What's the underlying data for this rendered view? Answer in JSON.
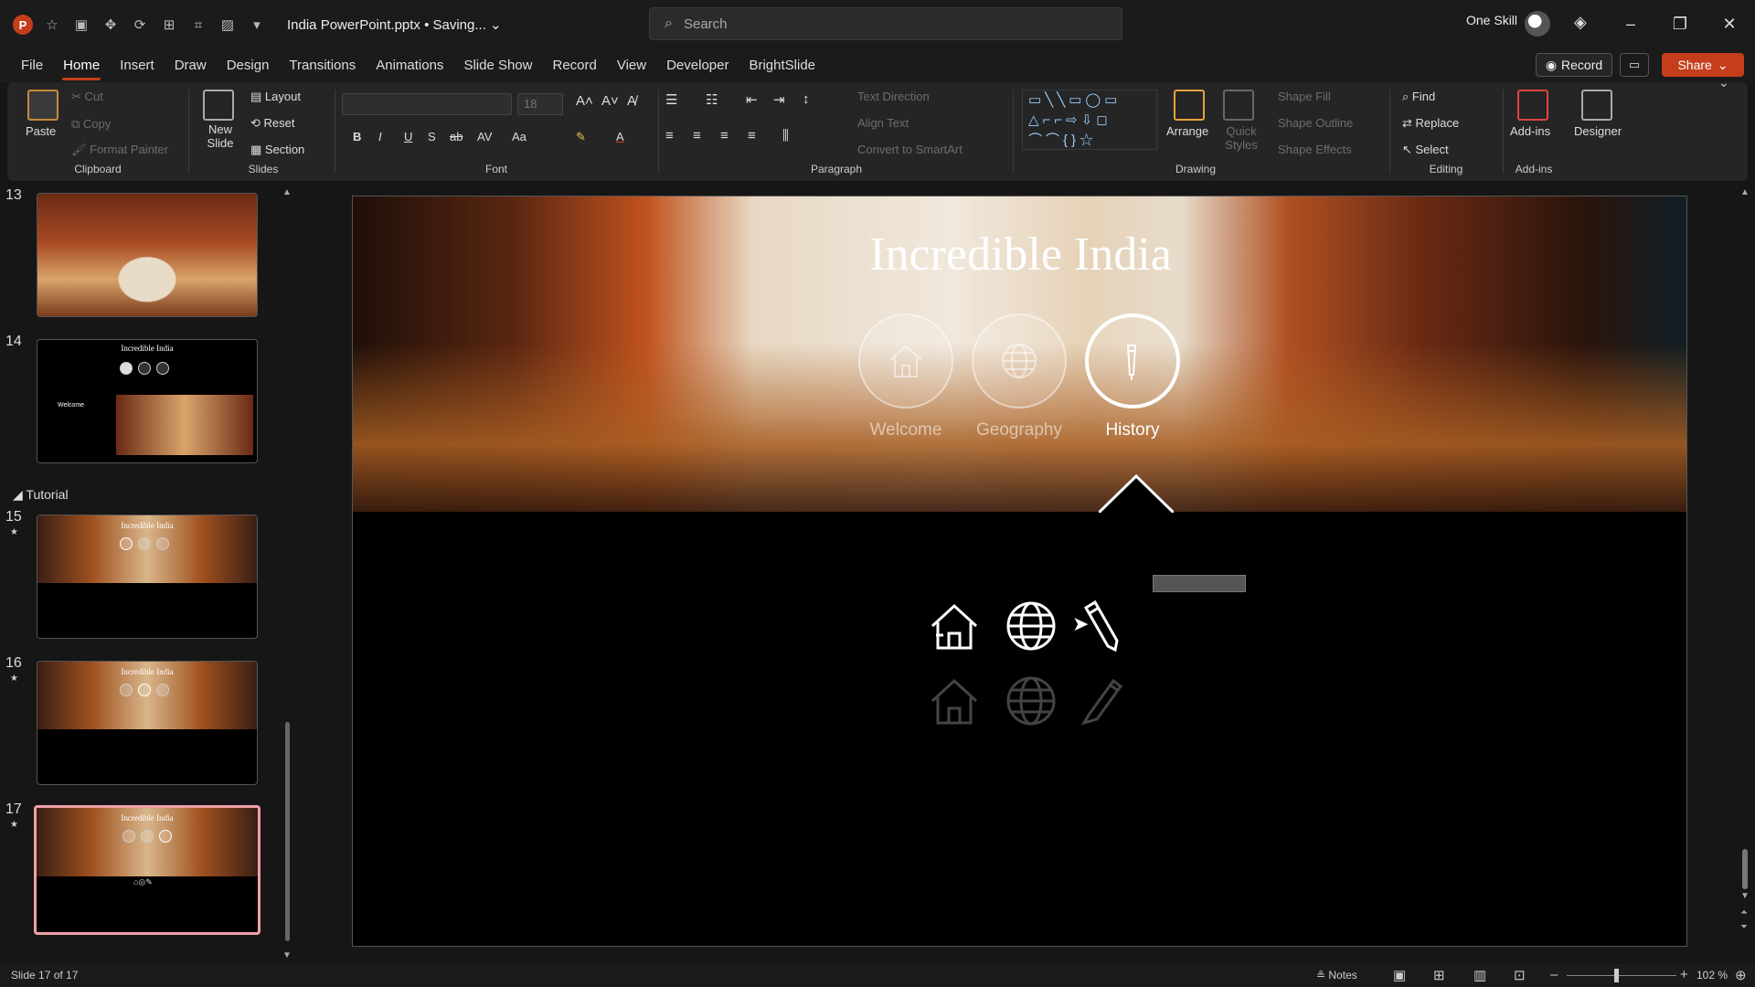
{
  "window": {
    "doc_title": "India PowerPoint.pptx • Saving...",
    "search_placeholder": "Search",
    "user_name": "One Skill"
  },
  "menu_tabs": [
    "File",
    "Home",
    "Insert",
    "Draw",
    "Design",
    "Transitions",
    "Animations",
    "Slide Show",
    "Record",
    "View",
    "Developer",
    "BrightSlide"
  ],
  "header_buttons": {
    "record": "Record",
    "share": "Share"
  },
  "ribbon": {
    "clipboard": {
      "label": "Clipboard",
      "paste": "Paste",
      "cut": "Cut",
      "copy": "Copy",
      "format_painter": "Format Painter"
    },
    "slides": {
      "label": "Slides",
      "new_slide": "New Slide",
      "layout": "Layout",
      "reset": "Reset",
      "section": "Section"
    },
    "font": {
      "label": "Font",
      "font_size": "18",
      "bold": "B",
      "italic": "I",
      "underline": "U",
      "shadow": "S",
      "strike": "ab",
      "spacing": "AV",
      "case": "Aa"
    },
    "paragraph": {
      "label": "Paragraph",
      "text_direction": "Text Direction",
      "align_text": "Align Text",
      "convert_smartart": "Convert to SmartArt"
    },
    "drawing": {
      "label": "Drawing",
      "arrange": "Arrange",
      "quick_styles": "Quick Styles",
      "shape_fill": "Shape Fill",
      "shape_outline": "Shape Outline",
      "shape_effects": "Shape Effects"
    },
    "editing": {
      "label": "Editing",
      "find": "Find",
      "replace": "Replace",
      "select": "Select"
    },
    "addins": {
      "label": "Add-ins",
      "addins": "Add-ins",
      "designer": "Designer"
    }
  },
  "slide_panel": {
    "section_name": "Tutorial",
    "slides": [
      {
        "num": "13",
        "star": false
      },
      {
        "num": "14",
        "star": false,
        "title": "Incredible India",
        "welcome": "Welcome"
      },
      {
        "num": "15",
        "star": true,
        "title": "Incredible India"
      },
      {
        "num": "16",
        "star": true,
        "title": "Incredible India"
      },
      {
        "num": "17",
        "star": true,
        "title": "Incredible India"
      }
    ]
  },
  "slide": {
    "title": "Incredible India",
    "nav": [
      {
        "label": "Welcome",
        "icon": "home-icon",
        "active": false
      },
      {
        "label": "Geography",
        "icon": "globe-icon",
        "active": false
      },
      {
        "label": "History",
        "icon": "pencil-icon",
        "active": true
      }
    ]
  },
  "status_bar": {
    "slide_info": "Slide 17 of 17",
    "notes": "Notes",
    "zoom": "102 %"
  },
  "colors": {
    "accent": "#c43e1c",
    "selection": "#f0a0a8"
  }
}
